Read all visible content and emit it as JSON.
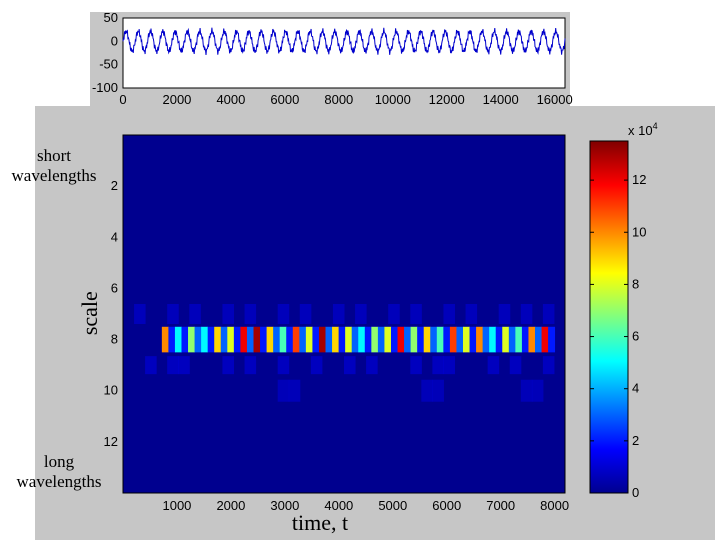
{
  "annotations": {
    "short": "short\nwavelengths",
    "long": "long\nwavelengths",
    "ylabel": "scale",
    "xlabel": "time, t"
  },
  "chart_data": [
    {
      "type": "line",
      "xlim": [
        0,
        16384
      ],
      "ylim": [
        -100,
        50
      ],
      "xticks": [
        "0",
        "2000",
        "4000",
        "6000",
        "8000",
        "10000",
        "12000",
        "14000",
        "16000"
      ],
      "yticks": [
        "50",
        "0",
        "-50",
        "-100"
      ],
      "series": [
        {
          "color": "#0000cc",
          "cycles": 36,
          "envelope": [
            -25,
            25
          ],
          "values": [
            0,
            15,
            28,
            20,
            -5,
            -22,
            -28,
            -12,
            8,
            22,
            18,
            -6,
            -20,
            -24,
            -8,
            10
          ]
        }
      ]
    },
    {
      "type": "heatmap",
      "xlim": [
        0,
        8192
      ],
      "ylim": [
        0,
        14
      ],
      "xticks": [
        "1000",
        "2000",
        "3000",
        "4000",
        "5000",
        "6000",
        "7000",
        "8000"
      ],
      "yticks": [
        "2",
        "4",
        "6",
        "8",
        "10",
        "12"
      ],
      "colorbar": {
        "range": [
          0,
          13.5
        ],
        "ticks": [
          "0",
          "2",
          "4",
          "6",
          "8",
          "10",
          "12"
        ],
        "multiplier_base": "x 10",
        "multiplier_exp": "4"
      },
      "bright_band": {
        "scale": 8,
        "time_start": 720,
        "time_end": 8000,
        "values": [
          10,
          2,
          5,
          2,
          7,
          3,
          5,
          2,
          9,
          3,
          8,
          2,
          12,
          3,
          13,
          2,
          9,
          3,
          6,
          2,
          11,
          3,
          8,
          2,
          13,
          3,
          9,
          2,
          8,
          3,
          5,
          2,
          7,
          3,
          8,
          2,
          12,
          3,
          7,
          2,
          9,
          3,
          6,
          2,
          11,
          3,
          8,
          2,
          10,
          3,
          5,
          2,
          8,
          3,
          6,
          2,
          10,
          3,
          12,
          2
        ]
      },
      "weak_band_scale7": [
        0,
        1,
        0,
        0,
        1,
        0,
        1,
        0,
        0,
        1,
        0,
        1,
        0,
        0,
        1,
        0,
        1,
        0,
        0,
        1,
        0,
        1,
        0,
        0,
        1,
        0,
        1,
        0,
        0,
        1,
        0,
        1,
        0,
        0,
        1,
        0,
        1,
        0,
        1,
        0
      ],
      "weak_band_scale9": [
        0,
        0,
        1,
        0,
        1,
        1,
        0,
        0,
        0,
        1,
        0,
        1,
        0,
        0,
        1,
        0,
        0,
        1,
        0,
        0,
        1,
        0,
        1,
        0,
        0,
        0,
        1,
        0,
        1,
        1,
        0,
        0,
        0,
        1,
        0,
        1,
        0,
        0,
        1,
        0
      ],
      "weak_band_scale10": [
        0,
        0,
        0,
        0,
        0,
        0,
        0,
        0,
        0,
        0,
        0,
        0,
        0,
        0,
        1,
        1,
        0,
        0,
        0,
        0,
        0,
        0,
        0,
        0,
        0,
        0,
        0,
        1,
        1,
        0,
        0,
        0,
        0,
        0,
        0,
        0,
        1,
        1,
        0,
        0
      ]
    }
  ]
}
